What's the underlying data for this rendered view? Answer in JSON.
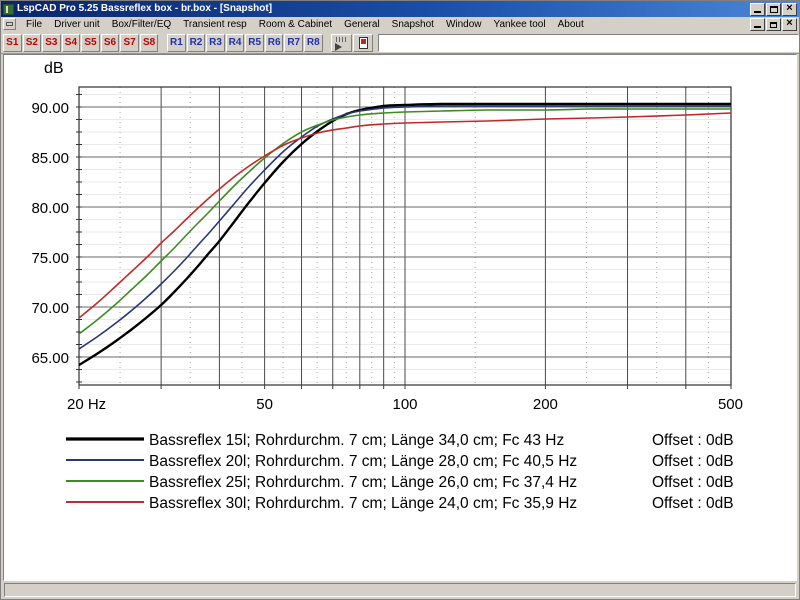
{
  "window": {
    "title": "LspCAD Pro 5.25 Bassreflex box - br.box - [Snapshot]",
    "icon": "speaker-icon",
    "controls": {
      "minimize": "Minimize",
      "maximize": "Maximize",
      "close": "Close"
    },
    "mdi_controls": {
      "minimize": "Minimize",
      "restore": "Restore",
      "close": "Close"
    }
  },
  "menu": {
    "system_icon": "mdi-system-icon",
    "items": [
      {
        "label": "File"
      },
      {
        "label": "Driver unit"
      },
      {
        "label": "Box/Filter/EQ"
      },
      {
        "label": "Transient resp"
      },
      {
        "label": "Room & Cabinet"
      },
      {
        "label": "General"
      },
      {
        "label": "Snapshot"
      },
      {
        "label": "Window"
      },
      {
        "label": "Yankee tool"
      },
      {
        "label": "About"
      }
    ]
  },
  "toolbar": {
    "snapshot_buttons": [
      "S1",
      "S2",
      "S3",
      "S4",
      "S5",
      "S6",
      "S7",
      "S8"
    ],
    "reference_buttons": [
      "R1",
      "R2",
      "R3",
      "R4",
      "R5",
      "R6",
      "R7",
      "R8"
    ],
    "tool_icons": [
      "cursor-readout-icon",
      "driver-properties-icon"
    ],
    "combo_value": "",
    "combo_placeholder": ""
  },
  "statusbar": {
    "text": ""
  },
  "chart_data": {
    "type": "line",
    "title": "",
    "ylabel": "dB",
    "xlabel": "",
    "xscale": "log",
    "xlim": [
      20,
      500
    ],
    "ylim": [
      62.2,
      92.0
    ],
    "grid": true,
    "x_ticks": [
      {
        "value": 20,
        "label": "20 Hz"
      },
      {
        "value": 30,
        "label": ""
      },
      {
        "value": 40,
        "label": ""
      },
      {
        "value": 50,
        "label": "50"
      },
      {
        "value": 60,
        "label": ""
      },
      {
        "value": 70,
        "label": ""
      },
      {
        "value": 80,
        "label": ""
      },
      {
        "value": 90,
        "label": ""
      },
      {
        "value": 100,
        "label": "100"
      },
      {
        "value": 200,
        "label": "200"
      },
      {
        "value": 300,
        "label": ""
      },
      {
        "value": 400,
        "label": ""
      },
      {
        "value": 500,
        "label": "500"
      }
    ],
    "y_ticks": [
      {
        "value": 90,
        "label": "90.00"
      },
      {
        "value": 85,
        "label": "85.00"
      },
      {
        "value": 80,
        "label": "80.00"
      },
      {
        "value": 75,
        "label": "75.00"
      },
      {
        "value": 70,
        "label": "70.00"
      },
      {
        "value": 65,
        "label": "65.00"
      }
    ],
    "legend_position": "bottom",
    "series": [
      {
        "name": "Bassreflex 15l; Rohrdurchm. 7 cm; Länge 34,0 cm; Fc 43 Hz",
        "offset_label": "Offset : 0dB",
        "color": "#000000",
        "width": 2.4,
        "x": [
          20,
          22,
          24,
          26,
          28,
          30,
          32,
          34,
          36,
          38,
          40,
          43,
          46,
          50,
          55,
          60,
          65,
          70,
          75,
          80,
          90,
          100,
          120,
          150,
          200,
          250,
          300,
          400,
          500
        ],
        "y": [
          64.2,
          65.4,
          66.6,
          67.8,
          69.0,
          70.2,
          71.5,
          72.8,
          74.1,
          75.4,
          76.6,
          78.5,
          80.3,
          82.4,
          84.6,
          86.3,
          87.6,
          88.6,
          89.3,
          89.7,
          90.1,
          90.2,
          90.3,
          90.3,
          90.3,
          90.3,
          90.3,
          90.3,
          90.3
        ]
      },
      {
        "name": "Bassreflex 20l; Rohrdurchm. 7 cm; Länge 28,0 cm; Fc 40,5 Hz",
        "offset_label": "Offset : 0dB",
        "color": "#253776",
        "width": 1.6,
        "x": [
          20,
          22,
          24,
          26,
          28,
          30,
          32,
          34,
          36,
          38,
          40,
          43,
          46,
          50,
          55,
          60,
          65,
          70,
          75,
          80,
          90,
          100,
          120,
          150,
          200,
          250,
          300,
          400,
          500
        ],
        "y": [
          65.8,
          67.1,
          68.4,
          69.7,
          71.0,
          72.3,
          73.6,
          74.9,
          76.2,
          77.4,
          78.6,
          80.3,
          81.9,
          83.7,
          85.6,
          87.0,
          88.1,
          88.8,
          89.3,
          89.6,
          89.9,
          90.0,
          90.1,
          90.1,
          90.1,
          90.1,
          90.1,
          90.1,
          90.1
        ]
      },
      {
        "name": "Bassreflex 25l; Rohrdurchm. 7 cm; Länge 26,0 cm; Fc 37,4 Hz",
        "offset_label": "Offset : 0dB",
        "color": "#3d8b22",
        "width": 1.6,
        "x": [
          20,
          22,
          24,
          26,
          28,
          30,
          32,
          34,
          36,
          38,
          40,
          43,
          46,
          50,
          55,
          60,
          65,
          70,
          75,
          80,
          90,
          100,
          120,
          150,
          200,
          250,
          300,
          400,
          500
        ],
        "y": [
          67.3,
          68.8,
          70.3,
          71.8,
          73.2,
          74.6,
          75.9,
          77.2,
          78.4,
          79.5,
          80.6,
          82.1,
          83.4,
          84.9,
          86.4,
          87.5,
          88.2,
          88.7,
          89.0,
          89.2,
          89.4,
          89.5,
          89.6,
          89.7,
          89.7,
          89.8,
          89.8,
          89.8,
          89.8
        ]
      },
      {
        "name": "Bassreflex 30l; Rohrdurchm. 7 cm; Länge 24,0 cm; Fc 35,9 Hz",
        "offset_label": "Offset : 0dB",
        "color": "#c02a28",
        "width": 1.6,
        "x": [
          20,
          22,
          24,
          26,
          28,
          30,
          32,
          34,
          36,
          38,
          40,
          43,
          46,
          50,
          55,
          60,
          65,
          70,
          75,
          80,
          90,
          100,
          120,
          150,
          200,
          250,
          300,
          400,
          500
        ],
        "y": [
          68.9,
          70.5,
          72.1,
          73.6,
          75.0,
          76.4,
          77.6,
          78.8,
          79.9,
          80.9,
          81.8,
          83.0,
          84.0,
          85.1,
          86.2,
          86.9,
          87.4,
          87.7,
          87.9,
          88.1,
          88.3,
          88.4,
          88.5,
          88.6,
          88.8,
          88.9,
          89.0,
          89.2,
          89.4
        ]
      }
    ]
  }
}
